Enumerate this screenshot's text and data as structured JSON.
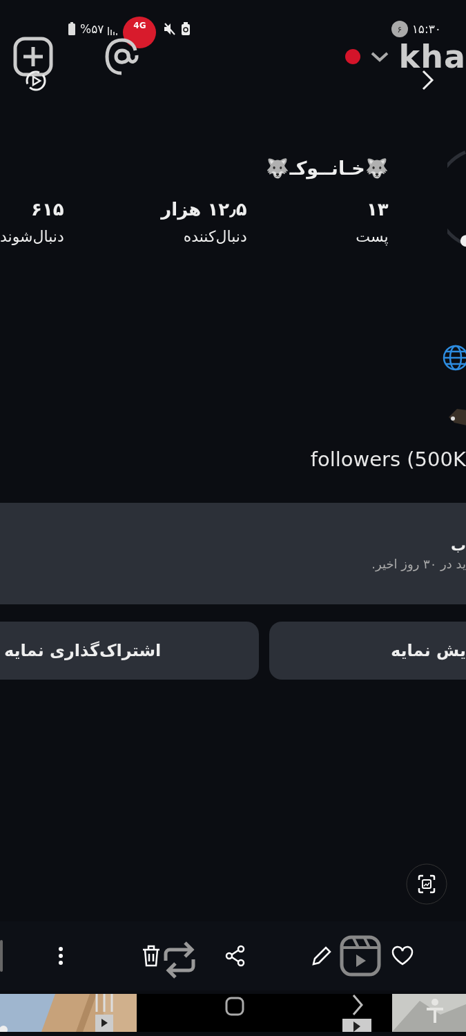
{
  "status_bar": {
    "battery": "%۵۷",
    "network": "4G",
    "notification_count": "۶",
    "time": "۱۵:۳۰"
  },
  "top_bar": {
    "username": "kha"
  },
  "profile": {
    "name": "🐺خـانــوکـ🐺",
    "stats": [
      {
        "value": "۱۳",
        "label": "پست"
      },
      {
        "value": "۱۲٫۵ هزار",
        "label": "دنبال‌کننده"
      },
      {
        "value": "۶۱۵",
        "label": "دنبال‌شوند"
      }
    ],
    "bio_line": "followers (500K"
  },
  "dashboard_card": {
    "title": "ب",
    "subtitle": "ید در ۳۰ روز اخیر."
  },
  "buttons": [
    {
      "label": "یش نمایه"
    },
    {
      "label": "اشتراک‌گذاری نمایه"
    }
  ]
}
